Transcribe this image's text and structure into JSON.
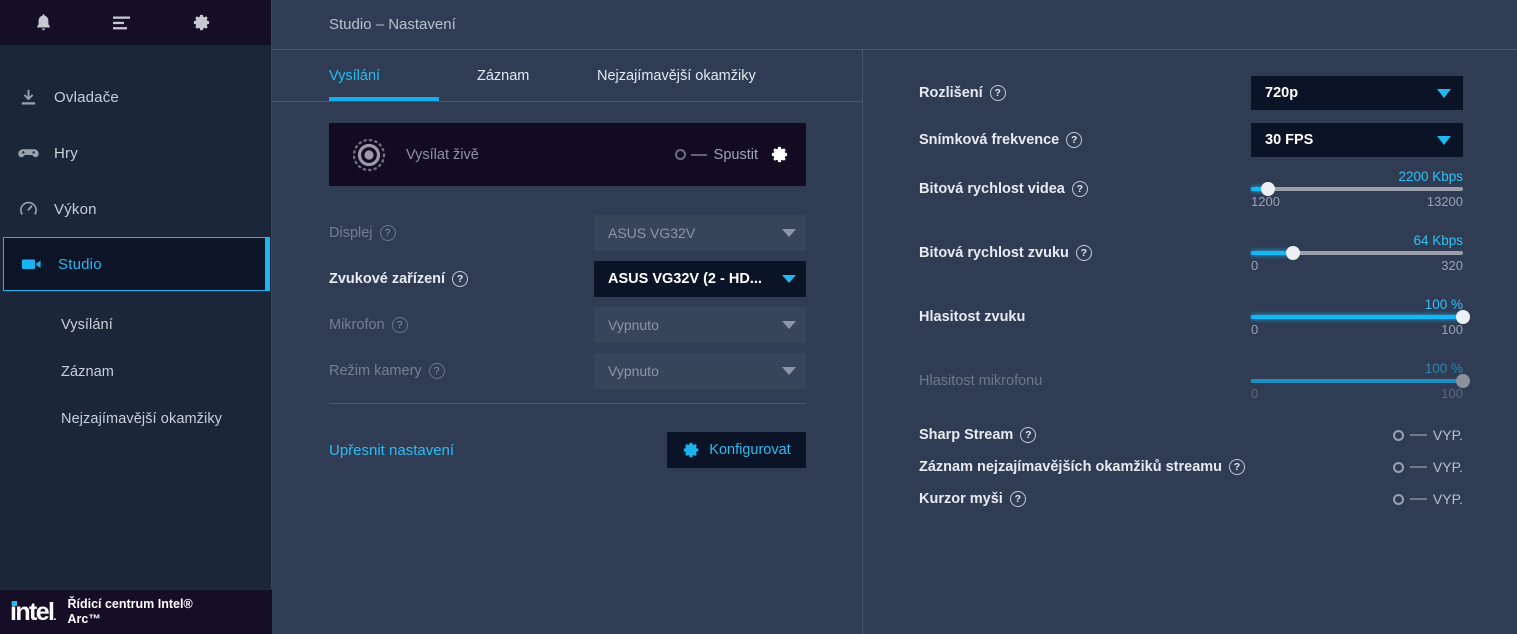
{
  "sidebar": {
    "topbar_icons": [
      {
        "name": "bell-icon",
        "label": "Oznámení"
      },
      {
        "name": "list-icon",
        "label": "Nabídka"
      },
      {
        "name": "gear-icon",
        "label": "Nastavení"
      }
    ],
    "items": [
      {
        "label": "Ovladače",
        "icon": "download-icon",
        "active": false
      },
      {
        "label": "Hry",
        "icon": "gamepad-icon",
        "active": false
      },
      {
        "label": "Výkon",
        "icon": "gauge-icon",
        "active": false
      },
      {
        "label": "Studio",
        "icon": "video-camera-icon",
        "active": true
      }
    ],
    "subitems": [
      {
        "label": "Vysílání"
      },
      {
        "label": "Záznam"
      },
      {
        "label": "Nejzajímavější okamžiky"
      }
    ],
    "footer": {
      "logo": "intel",
      "product": "Řídicí centrum Intel® Arc™"
    }
  },
  "header": {
    "title": "Studio – Nastavení"
  },
  "tabs": [
    {
      "label": "Vysílání",
      "active": true
    },
    {
      "label": "Záznam",
      "active": false
    },
    {
      "label": "Nejzajímavější okamžiky",
      "active": false
    }
  ],
  "stream_banner": {
    "icon": "record-icon",
    "label": "Vysílat živě",
    "toggle_state": "off",
    "action_label": "Spustit",
    "gear_icon": "gear-icon"
  },
  "left_settings": [
    {
      "label": "Displej",
      "help": "?",
      "value": "ASUS VG32V",
      "disabled": true
    },
    {
      "label": "Zvukové zařízení",
      "help": "?",
      "value": "ASUS VG32V (2 - HD...",
      "disabled": false
    },
    {
      "label": "Mikrofon",
      "help": "?",
      "value": "Vypnuto",
      "disabled": true
    },
    {
      "label": "Režim kamery",
      "help": "?",
      "value": "Vypnuto",
      "disabled": true
    }
  ],
  "advanced": {
    "label": "Upřesnit nastavení",
    "button_label": "Konfigurovat",
    "button_icon": "gear-icon"
  },
  "right_settings": {
    "dropdowns": [
      {
        "label": "Rozlišení",
        "help": "?",
        "value": "720p"
      },
      {
        "label": "Snímková frekvence",
        "help": "?",
        "value": "30 FPS"
      }
    ],
    "sliders": [
      {
        "label": "Bitová rychlost videa",
        "help": "?",
        "value": "2200 Kbps",
        "min": "1200",
        "max": "13200",
        "percent": 8,
        "disabled": false
      },
      {
        "label": "Bitová rychlost zvuku",
        "help": "?",
        "value": "64 Kbps",
        "min": "0",
        "max": "320",
        "percent": 20,
        "disabled": false
      },
      {
        "label": "Hlasitost zvuku",
        "help": "",
        "value": "100 %",
        "min": "0",
        "max": "100",
        "percent": 100,
        "disabled": false
      },
      {
        "label": "Hlasitost mikrofonu",
        "help": "",
        "value": "100 %",
        "min": "0",
        "max": "100",
        "percent": 100,
        "disabled": true
      }
    ],
    "toggles": [
      {
        "label": "Sharp Stream",
        "help": "?",
        "state": "VYP."
      },
      {
        "label": "Záznam nejzajímavějších okamžiků streamu",
        "help": "?",
        "state": "VYP."
      },
      {
        "label": "Kurzor myši",
        "help": "?",
        "state": "VYP."
      }
    ]
  },
  "colors": {
    "accent": "#12b0ef",
    "bg": "#2f3c54",
    "sidebar_bg": "#1c2639",
    "dark_panel": "#0b1326",
    "banner_bg": "#130b22"
  }
}
